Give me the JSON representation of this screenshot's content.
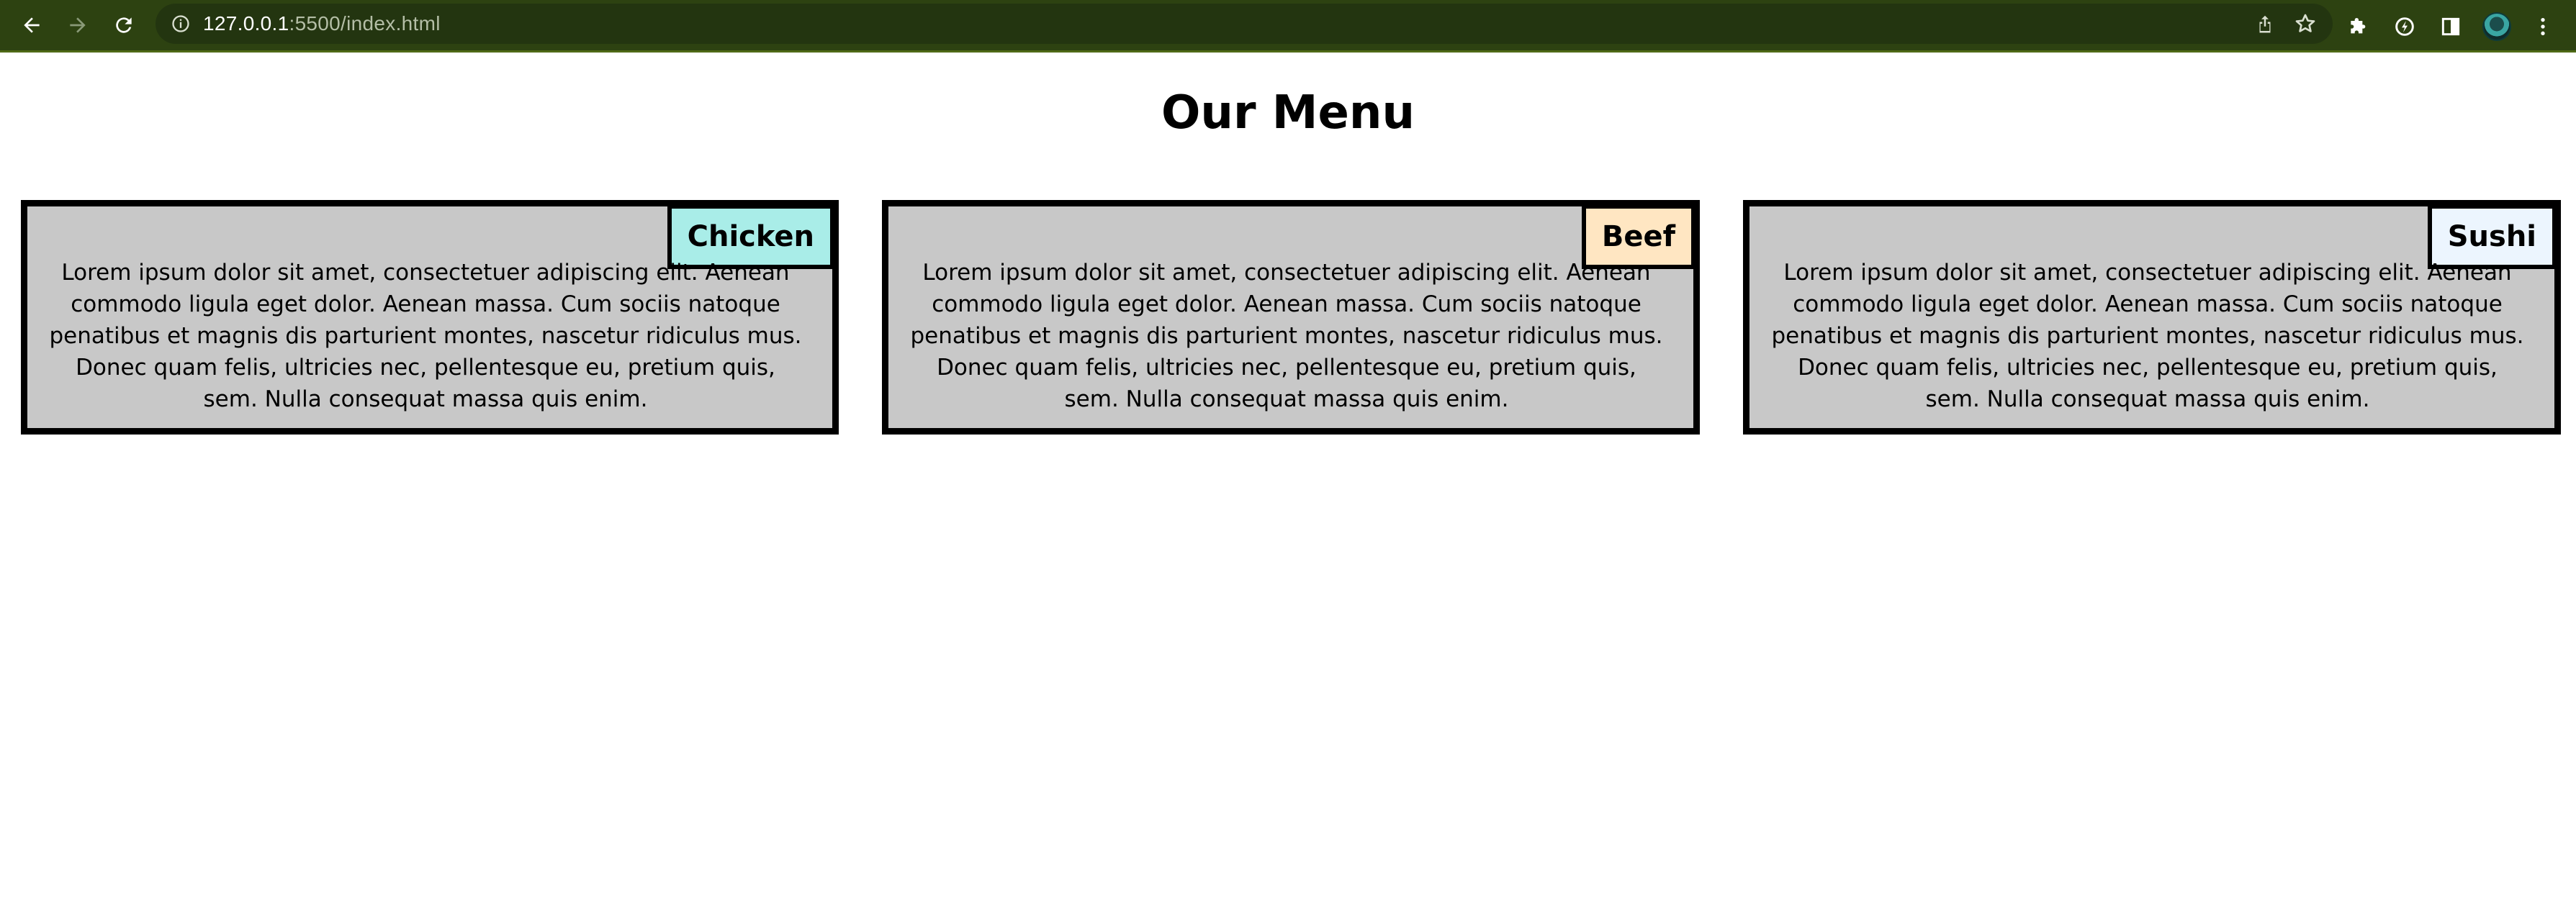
{
  "browser": {
    "url_host": "127.0.0.1",
    "url_rest": ":5500/index.html"
  },
  "page": {
    "title": "Our Menu"
  },
  "cards": [
    {
      "tag": "Chicken",
      "tag_color": "#a9ede8",
      "text": "Lorem ipsum dolor sit amet, consectetuer adipiscing elit. Aenean commodo ligula eget dolor. Aenean massa. Cum sociis natoque penatibus et magnis dis parturient montes, nascetur ridiculus mus. Donec quam felis, ultricies nec, pellentesque eu, pretium quis, sem. Nulla consequat massa quis enim."
    },
    {
      "tag": "Beef",
      "tag_color": "#ffe6c2",
      "text": "Lorem ipsum dolor sit amet, consectetuer adipiscing elit. Aenean commodo ligula eget dolor. Aenean massa. Cum sociis natoque penatibus et magnis dis parturient montes, nascetur ridiculus mus. Donec quam felis, ultricies nec, pellentesque eu, pretium quis, sem. Nulla consequat massa quis enim."
    },
    {
      "tag": "Sushi",
      "tag_color": "#ecf5fe",
      "text": "Lorem ipsum dolor sit amet, consectetuer adipiscing elit. Aenean commodo ligula eget dolor. Aenean massa. Cum sociis natoque penatibus et magnis dis parturient montes, nascetur ridiculus mus. Donec quam felis, ultricies nec, pellentesque eu, pretium quis, sem. Nulla consequat massa quis enim."
    }
  ],
  "icons": {
    "back": "back-arrow-icon",
    "forward": "forward-arrow-icon",
    "reload": "reload-icon",
    "info": "info-icon",
    "share": "share-icon",
    "bookmark": "star-icon",
    "extensions": "puzzle-icon",
    "sync": "sync-icon",
    "sidepanel": "side-panel-icon",
    "menu": "kebab-menu-icon"
  }
}
